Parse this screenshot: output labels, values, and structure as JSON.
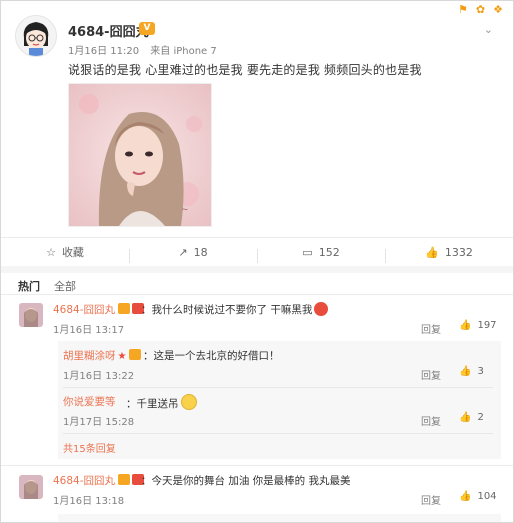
{
  "post": {
    "username": "4684-囧囧丸",
    "date": "1月16日 11:20",
    "source": "来自 iPhone 7",
    "text": "说狠话的是我  心里难过的也是我   要先走的是我  频频回头的也是我"
  },
  "actions": {
    "favorite_label": "收藏",
    "repost_count": "18",
    "comment_count": "152",
    "like_count": "1332"
  },
  "comment_tabs": {
    "hot": "热门",
    "all": "全部"
  },
  "comments": [
    {
      "name": "4684-囧囧丸",
      "text": "：我什么时候说过不要你了 干嘛黑我",
      "time": "1月16日 13:17",
      "reply_label": "回复",
      "likes": "197",
      "replies": [
        {
          "name": "胡里糊涂呀",
          "text": "：这是一个去北京的好借口！",
          "time": "1月16日 13:22",
          "reply_label": "回复",
          "likes": "3"
        },
        {
          "name": "你说爱要等",
          "text": "：千里送吊",
          "time": "1月17日 15:28",
          "reply_label": "回复",
          "likes": "2"
        }
      ],
      "more_replies": "共15条回复"
    },
    {
      "name": "4684-囧囧丸",
      "text": "：今天是你的舞台 加油 你是最棒的 我丸最美",
      "time": "1月16日 13:18",
      "reply_label": "回复",
      "likes": "104"
    }
  ],
  "colors": {
    "link": "#eb7350",
    "badge": "#f5a623"
  }
}
